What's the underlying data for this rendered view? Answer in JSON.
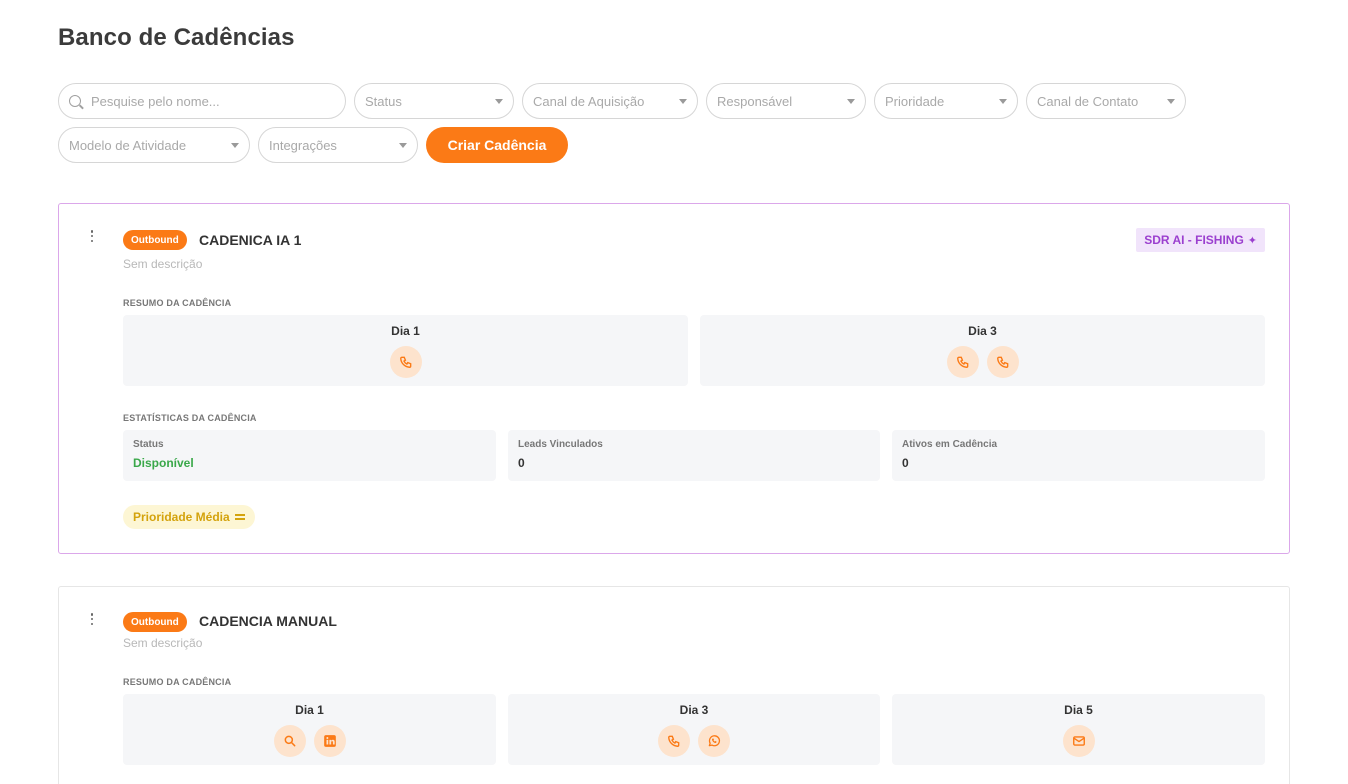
{
  "page": {
    "title": "Banco de Cadências"
  },
  "filters": {
    "search_placeholder": "Pesquise pelo nome...",
    "status": "Status",
    "canal_aquisicao": "Canal de Aquisição",
    "responsavel": "Responsável",
    "prioridade": "Prioridade",
    "canal_contato": "Canal de Contato",
    "modelo_atividade": "Modelo de Atividade",
    "integracoes": "Integrações"
  },
  "actions": {
    "create": "Criar Cadência"
  },
  "colors": {
    "accent": "#fb7a16",
    "ai": "#9b3fcf",
    "available": "#3aa84a",
    "priority": "#d4a30d"
  },
  "cadences": [
    {
      "type": "Outbound",
      "name": "CADENICA IA 1",
      "description": "Sem descrição",
      "tag": "SDR AI - FISHING",
      "summary_label": "RESUMO DA CADÊNCIA",
      "days": [
        {
          "label": "Dia 1",
          "icons": [
            "phone-icon"
          ]
        },
        {
          "label": "Dia 3",
          "icons": [
            "phone-icon",
            "phone-icon"
          ]
        }
      ],
      "stats_label": "ESTATÍSTICAS DA CADÊNCIA",
      "stats": {
        "status_label": "Status",
        "status_value": "Disponível",
        "leads_label": "Leads Vinculados",
        "leads_value": "0",
        "ativos_label": "Ativos em Cadência",
        "ativos_value": "0"
      },
      "priority": "Prioridade Média"
    },
    {
      "type": "Outbound",
      "name": "CADENCIA MANUAL",
      "description": "Sem descrição",
      "summary_label": "RESUMO DA CADÊNCIA",
      "days": [
        {
          "label": "Dia 1",
          "icons": [
            "search-icon",
            "linkedin-icon"
          ]
        },
        {
          "label": "Dia 3",
          "icons": [
            "phone-icon",
            "whatsapp-icon"
          ]
        },
        {
          "label": "Dia 5",
          "icons": [
            "email-icon"
          ]
        }
      ]
    }
  ]
}
